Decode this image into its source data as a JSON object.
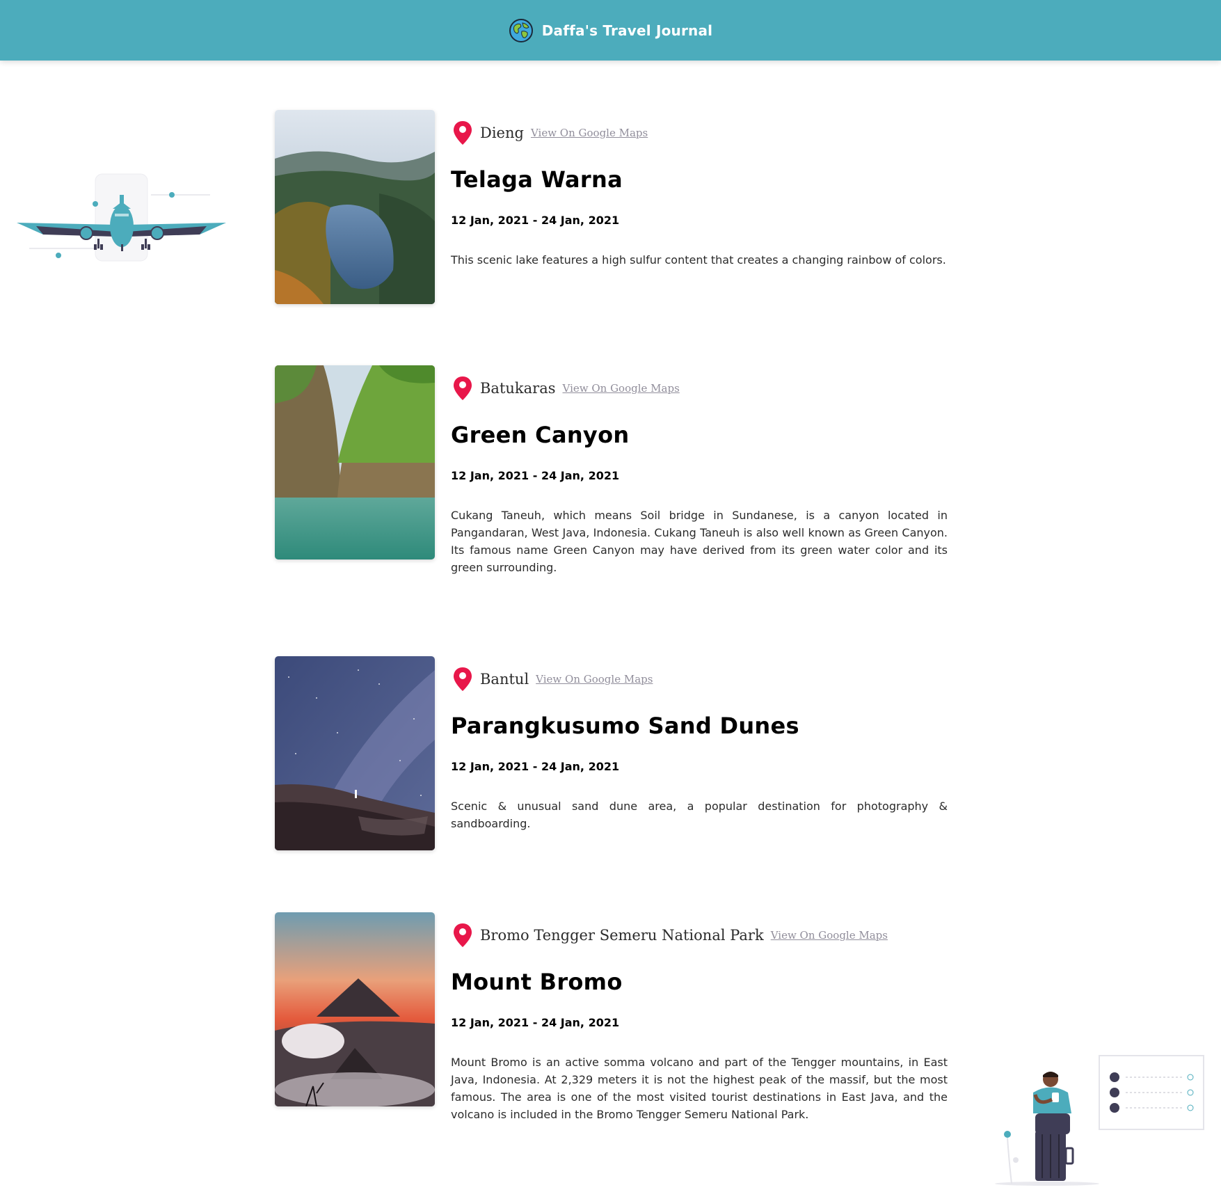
{
  "header": {
    "title": "Daffa's Travel Journal",
    "icon": "globe-icon",
    "background": "#4cacbc"
  },
  "colors": {
    "pin": "#e8174a",
    "accent": "#4cacbc"
  },
  "entries": [
    {
      "location": "Dieng",
      "map_link": "View On Google Maps",
      "title": "Telaga Warna",
      "dates": "12 Jan, 2021 - 24 Jan, 2021",
      "description": "This scenic lake features a high sulfur content that creates a changing rainbow of colors."
    },
    {
      "location": "Batukaras",
      "map_link": "View On Google Maps",
      "title": "Green Canyon",
      "dates": "12 Jan, 2021 - 24 Jan, 2021",
      "description": "Cukang Taneuh, which means Soil bridge in Sundanese, is a canyon located in Pangandaran, West Java, Indonesia. Cukang Taneuh is also well known as Green Canyon. Its famous name Green Canyon may have derived from its green water color and its green surrounding."
    },
    {
      "location": "Bantul",
      "map_link": "View On Google Maps",
      "title": "Parangkusumo Sand Dunes",
      "dates": "12 Jan, 2021 - 24 Jan, 2021",
      "description": "Scenic & unusual sand dune area, a popular destination for photography & sandboarding."
    },
    {
      "location": "Bromo Tengger Semeru National Park",
      "map_link": "View On Google Maps",
      "title": "Mount Bromo",
      "dates": "12 Jan, 2021 - 24 Jan, 2021",
      "description": "Mount Bromo is an active somma volcano and part of the Tengger mountains, in East Java, Indonesia. At 2,329 meters it is not the highest peak of the massif, but the most famous. The area is one of the most visited tourist destinations in East Java, and the volcano is included in the Bromo Tengger Semeru National Park."
    }
  ]
}
